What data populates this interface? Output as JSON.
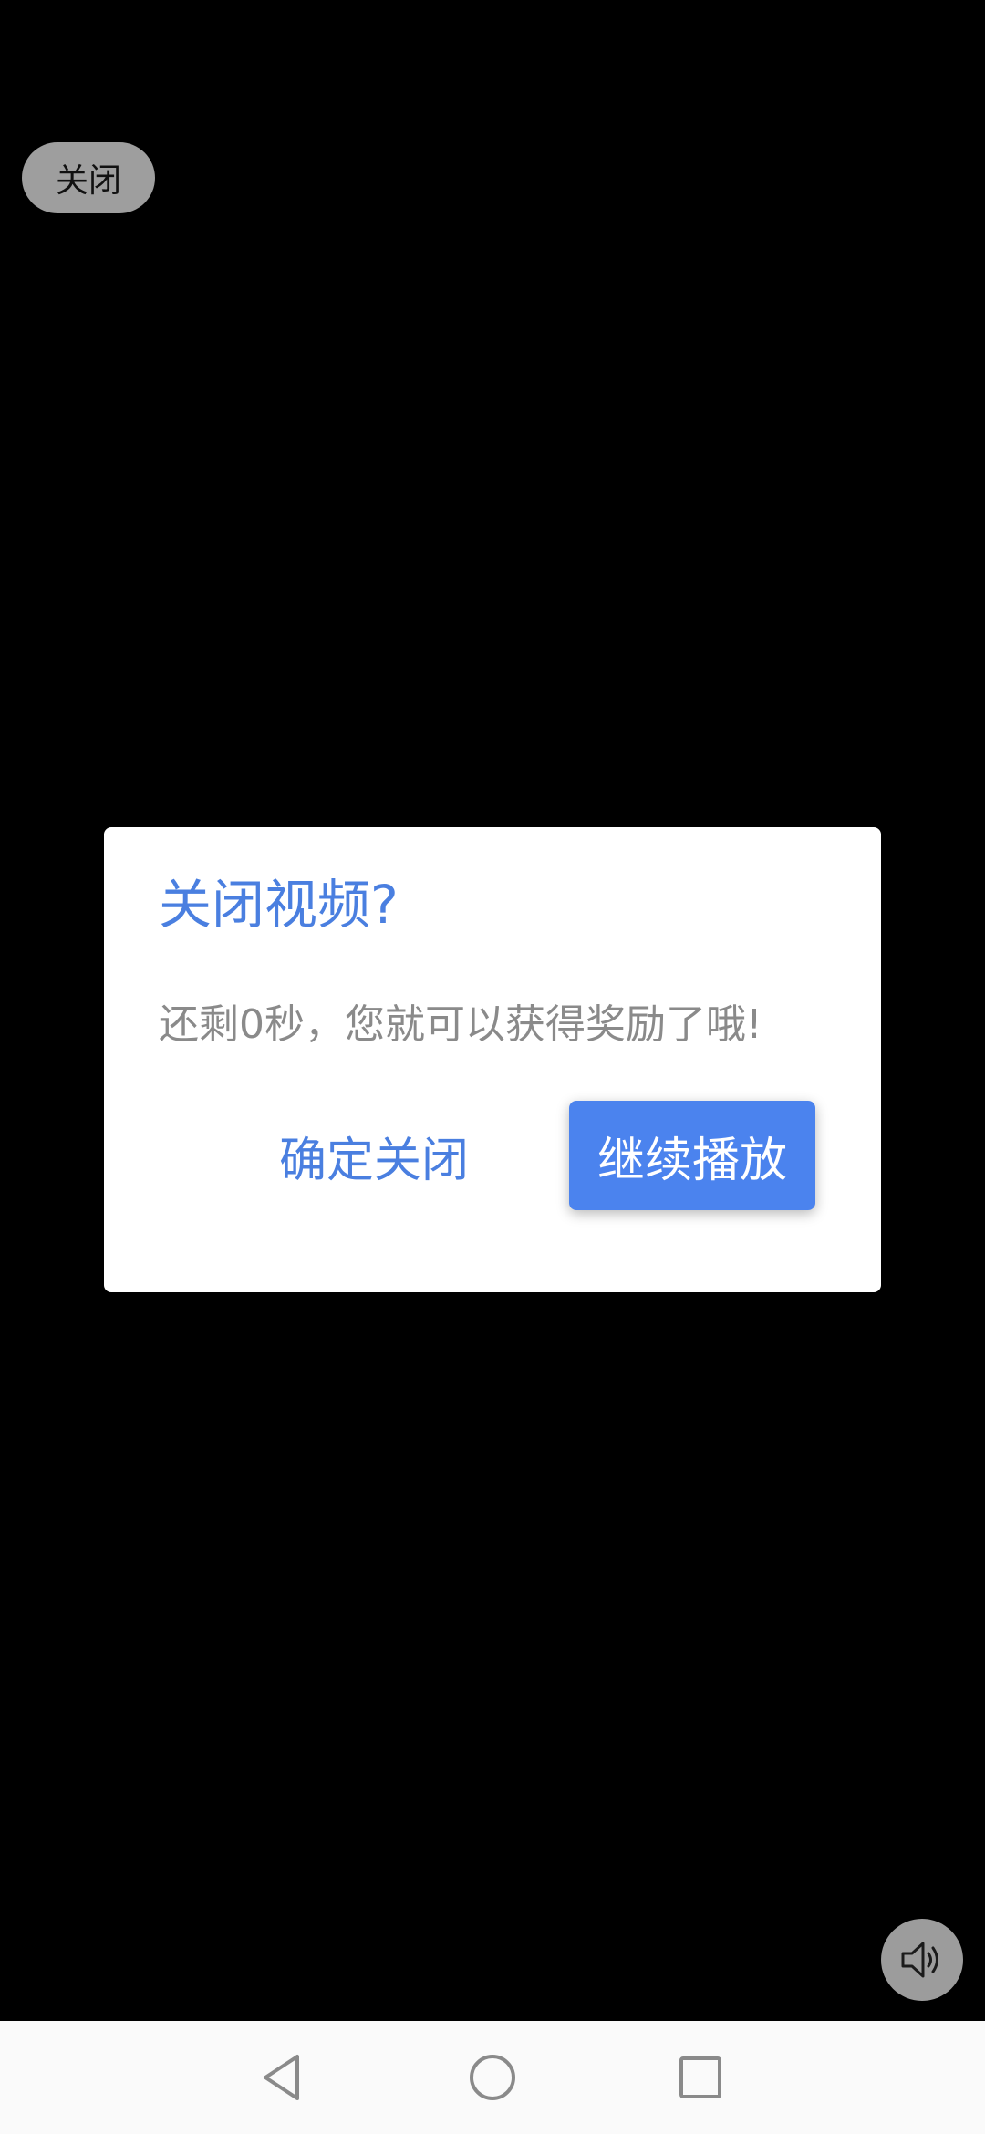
{
  "top_bar": {
    "close_label": "关闭"
  },
  "dialog": {
    "title": "关闭视频?",
    "message": "还剩0秒，您就可以获得奖励了哦!",
    "confirm_label": "确定关闭",
    "continue_label": "继续播放"
  },
  "controls": {
    "volume_icon": "speaker-icon"
  },
  "nav_bar": {
    "back_icon": "back-triangle-icon",
    "home_icon": "home-circle-icon",
    "recents_icon": "recents-square-icon"
  },
  "colors": {
    "accent": "#4a7fe0",
    "primary_button": "#4b83ee",
    "message_text": "#8a8a8a",
    "close_pill": "#9e9e9e"
  }
}
